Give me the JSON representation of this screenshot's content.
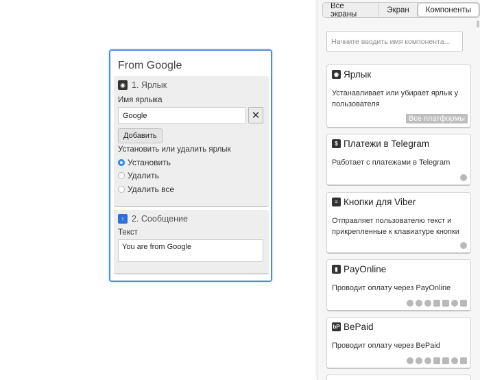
{
  "screen": {
    "title": "From Google",
    "block1": {
      "header": "1. Ярлык",
      "tag_name_label": "Имя ярлыка",
      "tag_name_value": "Google",
      "add_button": "Добавить",
      "action_label": "Установить или удалить ярлык",
      "options": [
        "Установить",
        "Удалить",
        "Удалить все"
      ],
      "selected_index": 0
    },
    "block2": {
      "header": "2. Сообщение",
      "text_label": "Текст",
      "text_value": "You are from Google"
    }
  },
  "panel": {
    "tabs": [
      "Все экраны",
      "Экран",
      "Компоненты"
    ],
    "active_tab": "Компоненты",
    "search_placeholder": "Начните вводить имя компонента...",
    "cards": [
      {
        "title": "Ярлык",
        "icon": "tag-icon",
        "desc": "Устанавливает или убирает ярлык у пользователя",
        "badge": "Все платформы"
      },
      {
        "title": "Платежи в Telegram",
        "icon": "dollar-icon",
        "desc": "Работает с платежами в Telegram",
        "platforms": [
          "telegram"
        ]
      },
      {
        "title": "Кнопки для Viber",
        "icon": "keyboard-icon",
        "desc": "Отправляет пользователю текст и прикрепленные к клавиатуре кнопки",
        "platforms": [
          "viber"
        ]
      },
      {
        "title": "PayOnline",
        "icon": "payonline-icon",
        "desc": "Проводит оплату через PayOnline",
        "platforms": [
          "messenger",
          "telegram",
          "viber",
          "vk",
          "ok",
          "whatsapp",
          "instagram"
        ]
      },
      {
        "title": "BePaid",
        "icon": "bepaid-icon",
        "desc": "Проводит оплату через BePaid",
        "platforms": [
          "messenger",
          "telegram",
          "viber",
          "vk",
          "ok",
          "whatsapp",
          "instagram"
        ]
      }
    ]
  },
  "colors": {
    "accent": "#4a90d9",
    "radio_on": "#2e86de",
    "message_icon": "#2e6fd8"
  }
}
